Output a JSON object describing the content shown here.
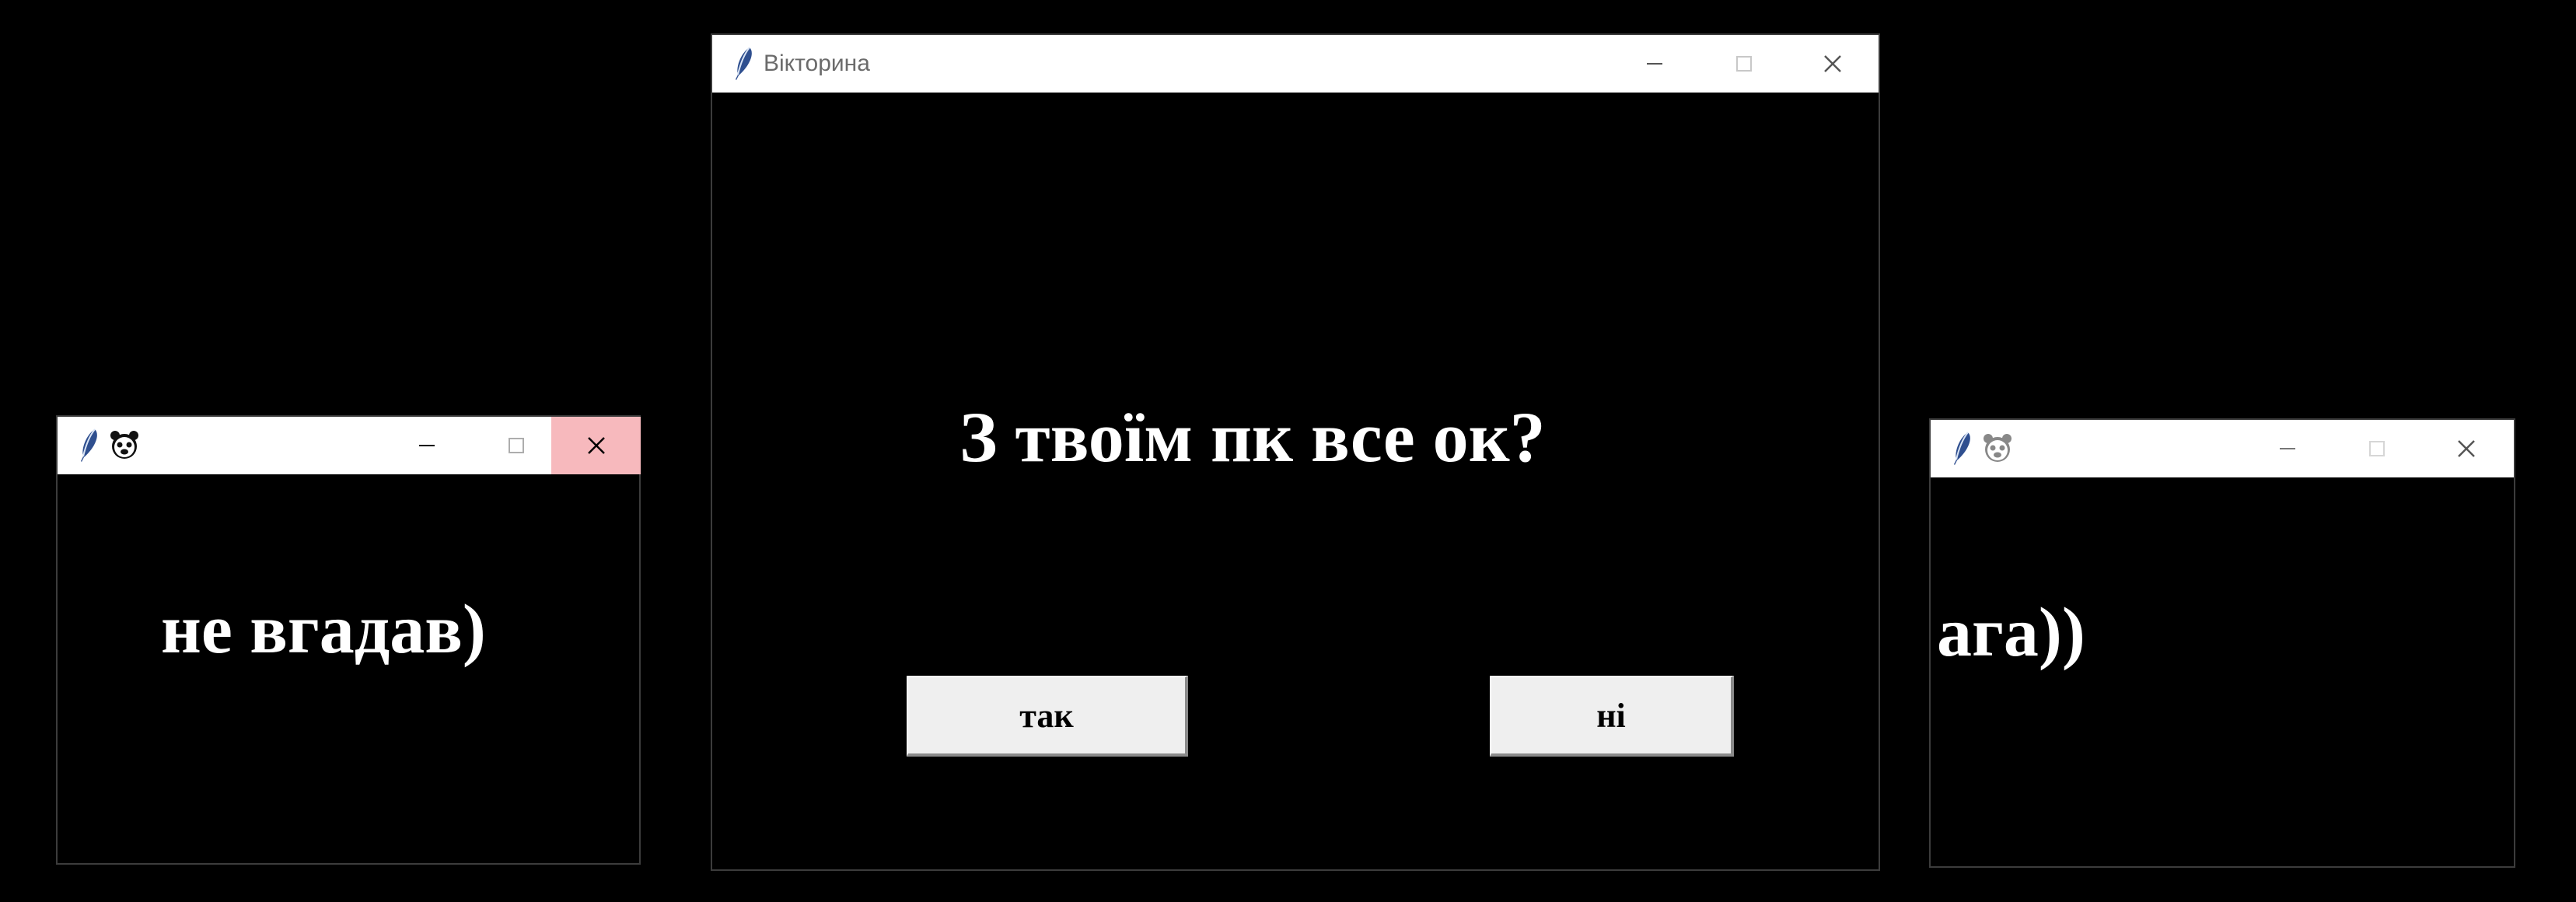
{
  "left_window": {
    "message": "не вгадав)",
    "controls": [
      "minimize-icon",
      "maximize-icon",
      "close-icon"
    ]
  },
  "main_window": {
    "title": "Вікторина",
    "question": "З твоїм пк все ок?",
    "yes_label": "так",
    "no_label": "ні",
    "controls": [
      "minimize-icon",
      "maximize-icon",
      "close-icon"
    ]
  },
  "right_window": {
    "message": "ага))",
    "controls": [
      "minimize-icon",
      "maximize-icon",
      "close-icon"
    ]
  },
  "colors": {
    "background": "#000000",
    "titlebar": "#ffffff",
    "close_hover": "#f7b9bd",
    "button": "#efefef",
    "text": "#ffffff"
  }
}
